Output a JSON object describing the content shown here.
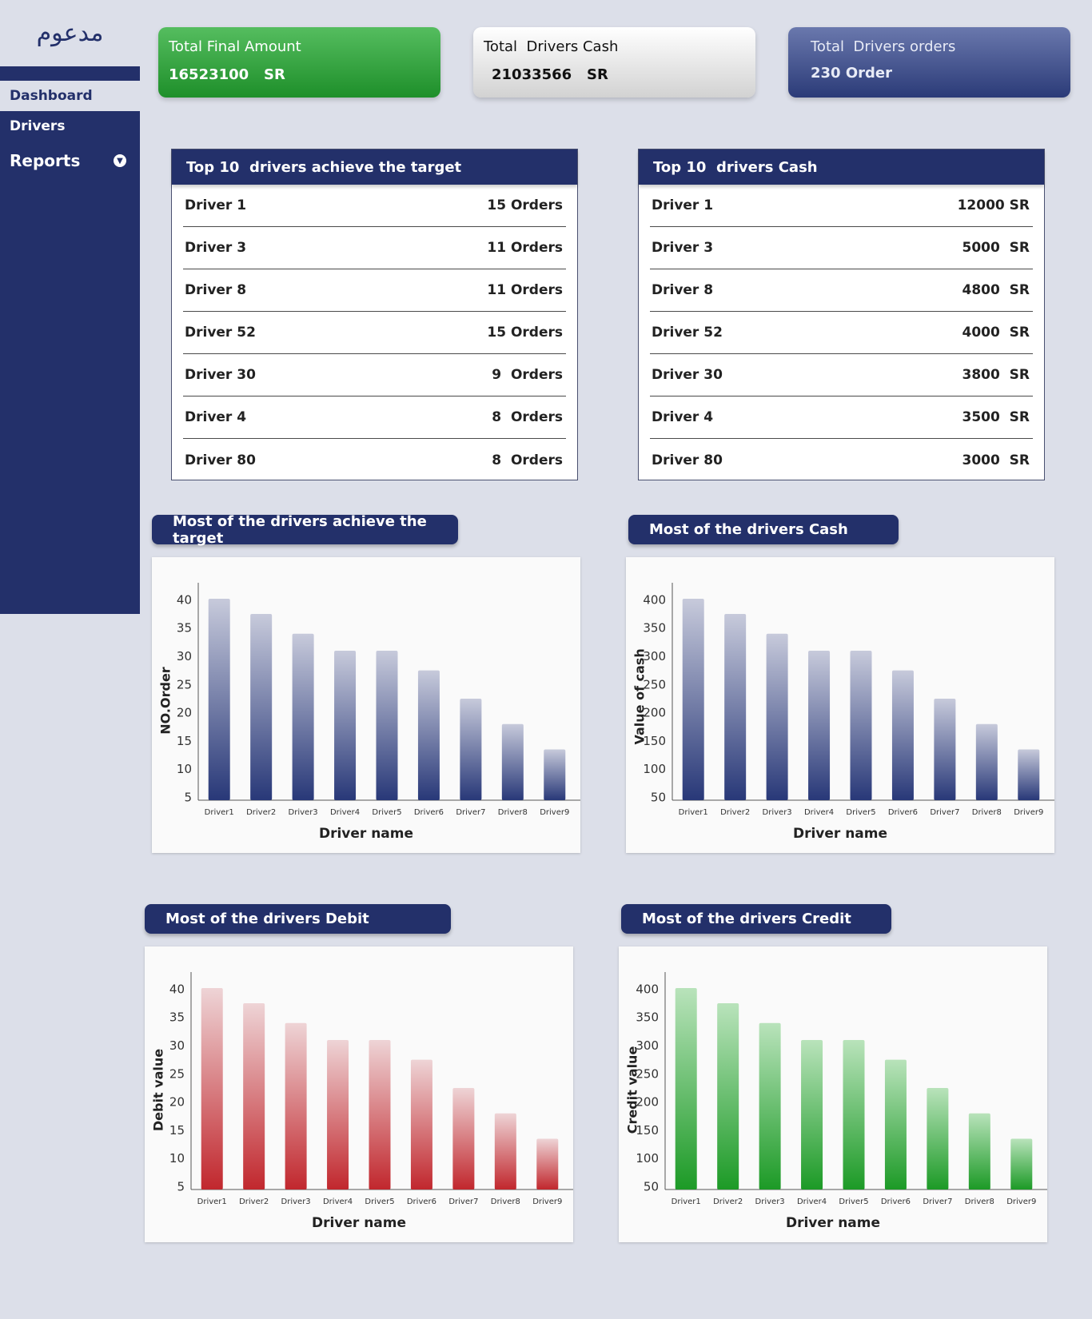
{
  "sidebar": {
    "logo": "مدعوم",
    "items": [
      {
        "label": "Dashboard"
      },
      {
        "label": "Drivers"
      },
      {
        "label": "Reports"
      }
    ]
  },
  "cards": {
    "final_amount": {
      "label": "Total Final Amount",
      "value": "16523100   SR"
    },
    "drivers_cash": {
      "label": "Total  Drivers Cash",
      "value": "21033566   SR"
    },
    "drivers_orders": {
      "label": "Total  Drivers orders",
      "value": "230 Order"
    }
  },
  "target_table": {
    "title": "Top 10  drivers achieve the target",
    "rows": [
      {
        "name": "Driver 1",
        "value": "15 Orders"
      },
      {
        "name": "Driver 3",
        "value": "11 Orders"
      },
      {
        "name": "Driver 8",
        "value": "11 Orders"
      },
      {
        "name": "Driver 52",
        "value": "15 Orders"
      },
      {
        "name": "Driver 30",
        "value": "9  Orders"
      },
      {
        "name": "Driver 4",
        "value": "8  Orders"
      },
      {
        "name": "Driver 80",
        "value": "8  Orders"
      }
    ]
  },
  "cash_table": {
    "title": "Top 10  drivers Cash",
    "rows": [
      {
        "name": "Driver 1",
        "value": "12000 SR"
      },
      {
        "name": "Driver 3",
        "value": "5000  SR"
      },
      {
        "name": "Driver 8",
        "value": "4800  SR"
      },
      {
        "name": "Driver 52",
        "value": "4000  SR"
      },
      {
        "name": "Driver 30",
        "value": "3800  SR"
      },
      {
        "name": "Driver 4",
        "value": "3500  SR"
      },
      {
        "name": "Driver 80",
        "value": "3000  SR"
      }
    ]
  },
  "chart_data": [
    {
      "type": "bar",
      "title": "Most of the drivers achieve the target",
      "xlabel": "Driver name",
      "ylabel": "NO.Order",
      "categories": [
        "Driver1",
        "Driver2",
        "Driver3",
        "Driver4",
        "Driver5",
        "Driver6",
        "Driver7",
        "Driver8",
        "Driver9"
      ],
      "values": [
        40.2,
        37.5,
        34,
        31,
        31,
        27.5,
        22.5,
        18,
        13.5
      ],
      "yticks": [
        5,
        10,
        15,
        20,
        25,
        30,
        35,
        40
      ],
      "ylim": [
        4.5,
        40.2
      ],
      "color_top": "#c7cadb",
      "color_bottom": "#283878"
    },
    {
      "type": "bar",
      "title": "Most of the drivers Cash",
      "xlabel": "Driver name",
      "ylabel": "Value of cash",
      "categories": [
        "Driver1",
        "Driver2",
        "Driver3",
        "Driver4",
        "Driver5",
        "Driver6",
        "Driver7",
        "Driver8",
        "Driver9"
      ],
      "values": [
        402,
        375,
        340,
        310,
        310,
        275,
        225,
        180,
        135
      ],
      "yticks": [
        50,
        100,
        150,
        200,
        250,
        300,
        350,
        400
      ],
      "ylim": [
        45,
        402
      ],
      "color_top": "#c7cadb",
      "color_bottom": "#283878"
    },
    {
      "type": "bar",
      "title": "Most of the drivers Debit",
      "xlabel": "Driver name",
      "ylabel": "Debit value",
      "categories": [
        "Driver1",
        "Driver2",
        "Driver3",
        "Driver4",
        "Driver5",
        "Driver6",
        "Driver7",
        "Driver8",
        "Driver9"
      ],
      "values": [
        40.2,
        37.5,
        34,
        31,
        31,
        27.5,
        22.5,
        18,
        13.5
      ],
      "yticks": [
        5,
        10,
        15,
        20,
        25,
        30,
        35,
        40
      ],
      "ylim": [
        4.5,
        40.2
      ],
      "color_top": "#eed4d6",
      "color_bottom": "#c1272d"
    },
    {
      "type": "bar",
      "title": "Most of the drivers Credit",
      "xlabel": "Driver name",
      "ylabel": "Credit value",
      "categories": [
        "Driver1",
        "Driver2",
        "Driver3",
        "Driver4",
        "Driver5",
        "Driver6",
        "Driver7",
        "Driver8",
        "Driver9"
      ],
      "values": [
        402,
        375,
        340,
        310,
        310,
        275,
        225,
        180,
        135
      ],
      "yticks": [
        50,
        100,
        150,
        200,
        250,
        300,
        350,
        400
      ],
      "ylim": [
        45,
        402
      ],
      "color_top": "#b9e3bb",
      "color_bottom": "#1c9a26"
    }
  ]
}
